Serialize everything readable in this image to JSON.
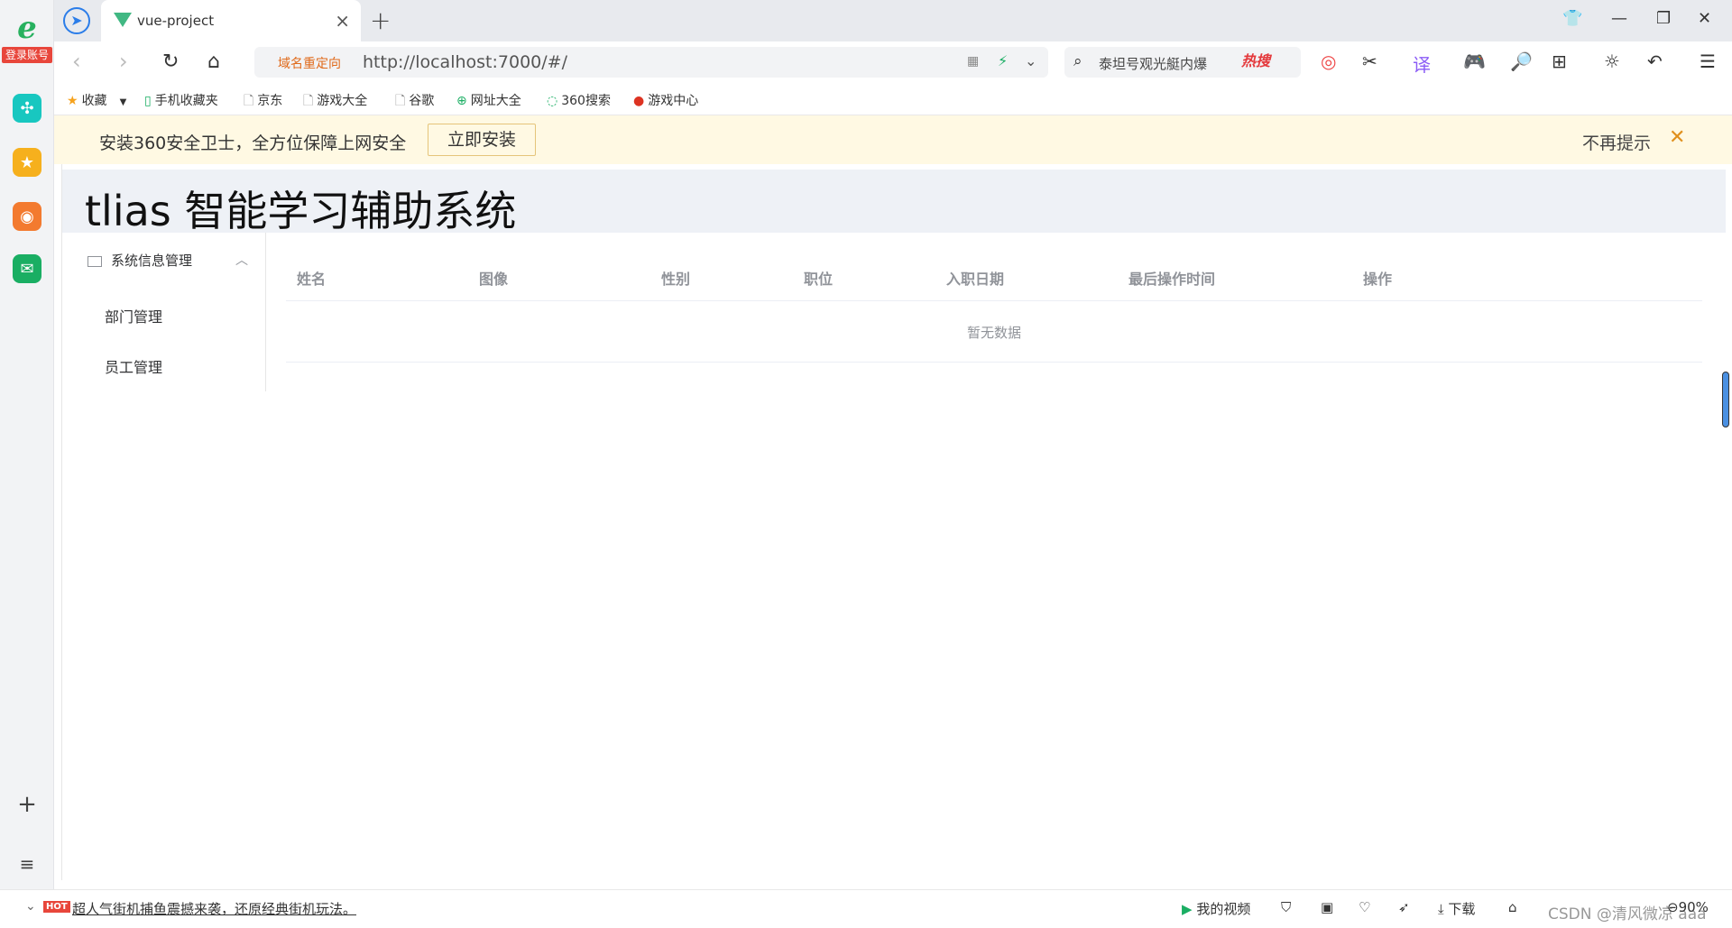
{
  "browser": {
    "login_badge": "登录账号",
    "tab_title": "vue-project",
    "redirect_label": "域名重定向",
    "url": "http://localhost:7000/#/",
    "search_query": "泰坦号观光艇内爆",
    "hot_search": "热搜"
  },
  "bookmarks": [
    {
      "label": "收藏",
      "icon": "star-icon"
    },
    {
      "label": "手机收藏夹",
      "icon": "phone-icon"
    },
    {
      "label": "京东",
      "icon": "page-icon"
    },
    {
      "label": "游戏大全",
      "icon": "page-icon"
    },
    {
      "label": "谷歌",
      "icon": "page-icon"
    },
    {
      "label": "网址大全",
      "icon": "plus-circle-icon"
    },
    {
      "label": "360搜索",
      "icon": "search-icon"
    },
    {
      "label": "游戏中心",
      "icon": "game-icon"
    }
  ],
  "notification": {
    "text": "安装360安全卫士，全方位保障上网安全",
    "install_button": "立即安装",
    "dismiss": "不再提示"
  },
  "app": {
    "title": "tlias 智能学习辅助系统",
    "sidebar": {
      "group": "系统信息管理",
      "items": [
        "部门管理",
        "员工管理"
      ]
    },
    "table": {
      "columns": [
        "姓名",
        "图像",
        "性别",
        "职位",
        "入职日期",
        "最后操作时间",
        "操作"
      ],
      "empty_text": "暂无数据"
    }
  },
  "statusbar": {
    "hot_badge": "HOT",
    "news": "超人气街机捕鱼震撼来袭，还原经典街机玩法。",
    "my_video": "我的视频",
    "download": "下载",
    "zoom": "90%",
    "watermark": "CSDN @清风微凉 aaa"
  }
}
